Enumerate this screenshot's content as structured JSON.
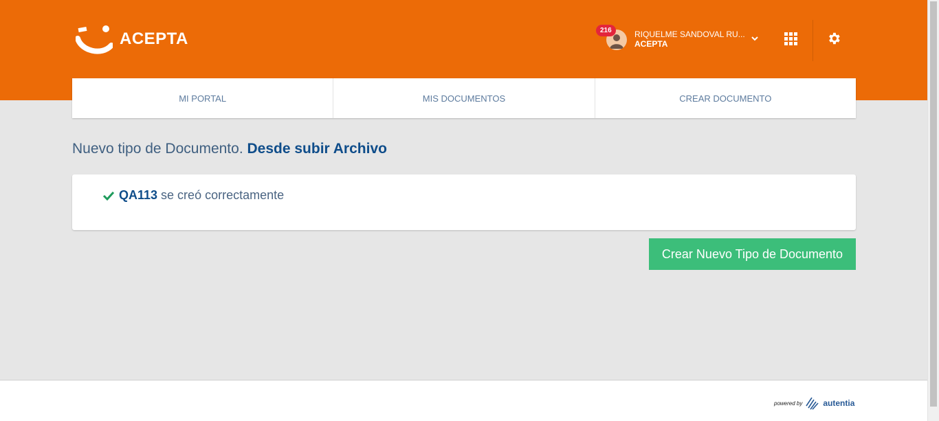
{
  "brand": {
    "name": "ACEPTA",
    "primary_color": "#ec6b07",
    "accent_green": "#3cbe7a"
  },
  "user": {
    "badge_count": "216",
    "name": "RIQUELME SANDOVAL RU...",
    "org": "ACEPTA"
  },
  "nav": {
    "tabs": [
      {
        "label": "MI PORTAL"
      },
      {
        "label": "MIS DOCUMENTOS"
      },
      {
        "label": "CREAR DOCUMENTO"
      }
    ]
  },
  "page": {
    "title_prefix": "Nuevo tipo de Documento.",
    "title_strong": "Desde subir Archivo"
  },
  "message": {
    "doc_code": "QA113",
    "text": "se creó correctamente"
  },
  "actions": {
    "create_new_label": "Crear Nuevo Tipo de Documento"
  },
  "footer": {
    "powered_by": "powered by",
    "company": "autentia"
  },
  "icons": [
    "acepta-logo-icon",
    "avatar-icon",
    "chevron-down-icon",
    "apps-grid-icon",
    "gear-icon",
    "check-icon",
    "autentia-logo-icon"
  ]
}
